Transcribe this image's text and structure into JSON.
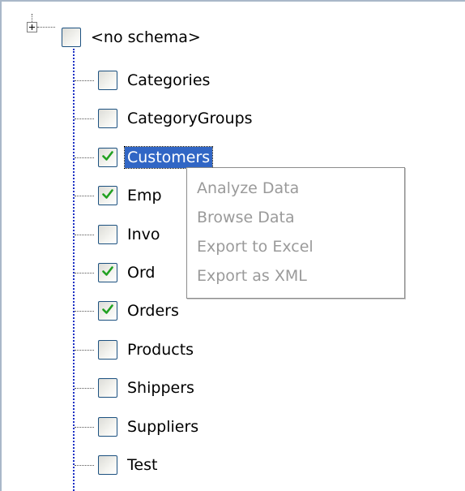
{
  "tree": {
    "root": {
      "label": "<no schema>",
      "checked": false,
      "expander_icon": "plus-expander-icon"
    },
    "items": [
      {
        "label": "Categories",
        "checked": false,
        "selected": false
      },
      {
        "label": "CategoryGroups",
        "checked": false,
        "selected": false
      },
      {
        "label": "Customers",
        "checked": true,
        "selected": true
      },
      {
        "label": "Emp",
        "checked": true,
        "selected": false
      },
      {
        "label": "Invo",
        "checked": false,
        "selected": false
      },
      {
        "label": "Ord",
        "checked": true,
        "selected": false
      },
      {
        "label": "Orders",
        "checked": true,
        "selected": false
      },
      {
        "label": "Products",
        "checked": false,
        "selected": false
      },
      {
        "label": "Shippers",
        "checked": false,
        "selected": false
      },
      {
        "label": "Suppliers",
        "checked": false,
        "selected": false
      },
      {
        "label": "Test",
        "checked": false,
        "selected": false
      }
    ]
  },
  "context_menu": {
    "items": [
      {
        "label": "Analyze Data",
        "enabled": false
      },
      {
        "label": "Browse Data",
        "enabled": false
      },
      {
        "label": "Export to Excel",
        "enabled": false
      },
      {
        "label": "Export as XML",
        "enabled": false
      }
    ]
  },
  "colors": {
    "selection_bg": "#3166c5",
    "checkmark": "#21a121",
    "tree_line": "#1a2fc4",
    "disabled_text": "#9a9a9a",
    "checkbox_border": "#1c5180"
  }
}
